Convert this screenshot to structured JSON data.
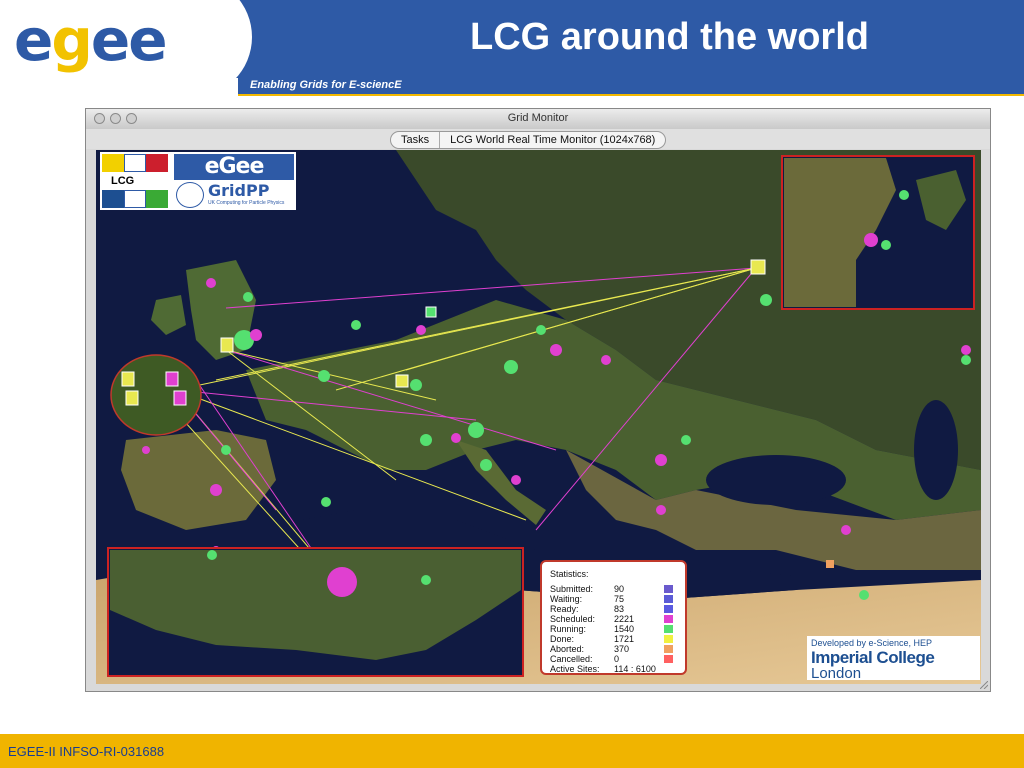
{
  "slide": {
    "logo_text": "egee",
    "title": "LCG around the world",
    "subtitle": "Enabling Grids for E-sciencE",
    "footer": "EGEE-II INFSO-RI-031688"
  },
  "window": {
    "title": "Grid Monitor",
    "tabs": [
      "Tasks",
      "LCG World Real Time Monitor (1024x768)"
    ]
  },
  "map_overlay": {
    "lcg_logo_text": "LCG",
    "egee_logo_text": "eGee",
    "gridpp_text": "GridPP",
    "gridpp_subtitle": "UK Computing for Particle Physics"
  },
  "statistics": {
    "title": "Statistics:",
    "rows": [
      {
        "label": "Submitted:",
        "value": "90",
        "color": "#6a5acd"
      },
      {
        "label": "Waiting:",
        "value": "75",
        "color": "#5b5bd6"
      },
      {
        "label": "Ready:",
        "value": "83",
        "color": "#5a5ae0"
      },
      {
        "label": "Scheduled:",
        "value": "2221",
        "color": "#e040d0"
      },
      {
        "label": "Running:",
        "value": "1540",
        "color": "#55e070"
      },
      {
        "label": "Done:",
        "value": "1721",
        "color": "#f0f040"
      },
      {
        "label": "Aborted:",
        "value": "370",
        "color": "#f0a060"
      },
      {
        "label": "Cancelled:",
        "value": "0",
        "color": "#ff6060"
      },
      {
        "label": "Active Sites:",
        "value": "114 : 6100",
        "color": ""
      }
    ]
  },
  "credits": {
    "developed_by": "Developed by e-Science, HEP",
    "college": "Imperial College",
    "city": "London"
  },
  "colors": {
    "egee_blue": "#2e5aa6",
    "footer_gold": "#f0b400",
    "inset_border": "#cc2222",
    "running_green": "#55e070",
    "scheduled_magenta": "#e040d0"
  }
}
